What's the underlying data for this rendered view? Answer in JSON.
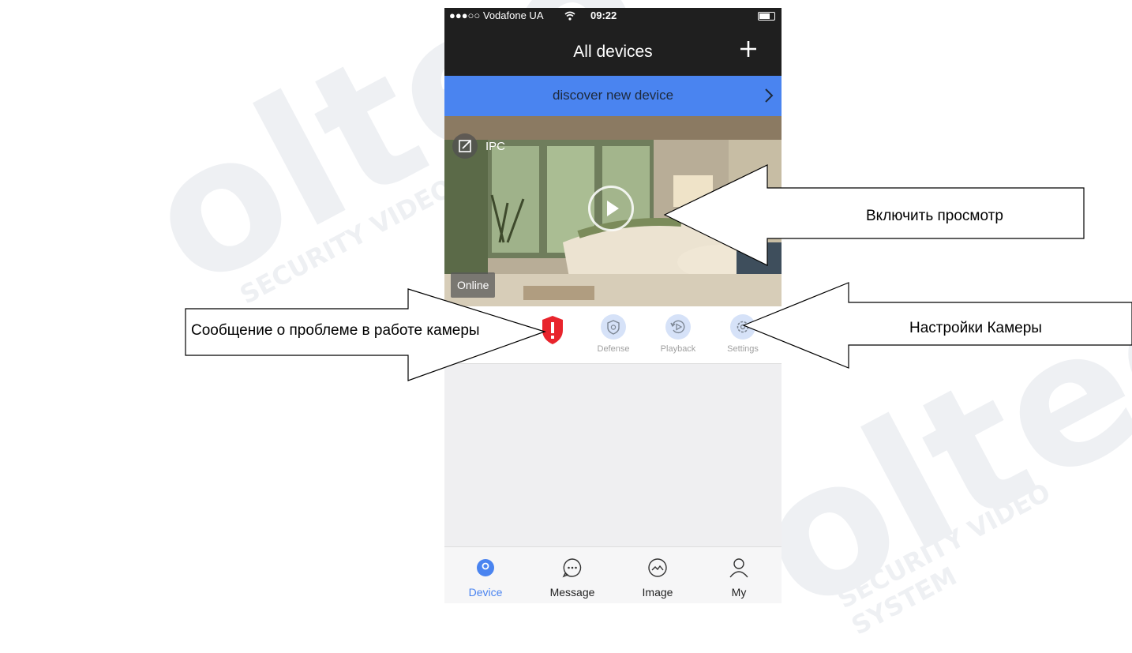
{
  "status_bar": {
    "carrier": "●●●○○ Vodafone UA ",
    "time": "09:22"
  },
  "header": {
    "title": "All devices"
  },
  "discover_bar": {
    "label": "discover new device"
  },
  "camera": {
    "name": "IPC",
    "status": "Online"
  },
  "actions": [
    {
      "id": "alarm",
      "label": ""
    },
    {
      "id": "defense",
      "label": "Defense"
    },
    {
      "id": "playback",
      "label": "Playback"
    },
    {
      "id": "settings",
      "label": "Settings"
    }
  ],
  "tabs": [
    {
      "label": "Device",
      "icon": "device-icon",
      "active": true
    },
    {
      "label": "Message",
      "icon": "message-icon",
      "active": false
    },
    {
      "label": "Image",
      "icon": "image-icon",
      "active": false
    },
    {
      "label": "My",
      "icon": "user-icon",
      "active": false
    }
  ],
  "annotations": {
    "play": "Включить просмотр",
    "alarm": "Сообщение о проблеме в работе камеры",
    "settings": "Настройки Камеры"
  },
  "watermark": {
    "brand": "olteo",
    "tagline": "SECURITY VIDEO SYSTEM"
  },
  "colors": {
    "accent": "#4a84f0",
    "bar": "#1f1f1f",
    "alarm": "#e8242c"
  }
}
